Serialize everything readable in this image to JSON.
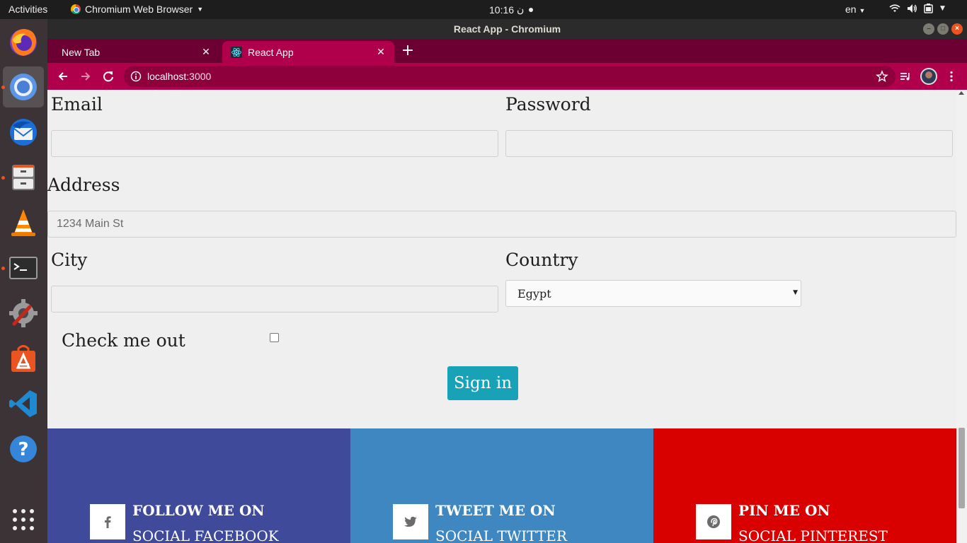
{
  "topbar": {
    "activities": "Activities",
    "app_name": "Chromium Web Browser",
    "clock": "10:16",
    "clock_suffix": "ن",
    "language": "en"
  },
  "window": {
    "title": "React App - Chromium"
  },
  "browser": {
    "tabs": [
      {
        "label": "New Tab",
        "active": false
      },
      {
        "label": "React App",
        "active": true
      }
    ],
    "url_host": "localhost",
    "url_port": ":3000"
  },
  "form": {
    "email_label": "Email",
    "email_value": "",
    "password_label": "Password",
    "password_value": "",
    "address_label": "Address",
    "address_placeholder": "1234 Main St",
    "city_label": "City",
    "city_value": "",
    "country_label": "Country",
    "country_selected": "Egypt",
    "check_label": "Check me out",
    "checked": false,
    "submit_label": "Sign in"
  },
  "social": [
    {
      "line1": "FOLLOW ME ON",
      "line2": "SOCIAL FACEBOOK",
      "color": "#3f4a9a",
      "icon": "facebook-icon"
    },
    {
      "line1": "TWEET ME ON",
      "line2": "SOCIAL TWITTER",
      "color": "#3f87c1",
      "icon": "twitter-icon"
    },
    {
      "line1": "PIN ME ON",
      "line2": "SOCIAL PINTEREST",
      "color": "#d90000",
      "icon": "pinterest-icon"
    }
  ],
  "colors": {
    "browser_accent": "#b0004b",
    "tabstrip": "#6d0032",
    "button_primary": "#17a2b8"
  }
}
